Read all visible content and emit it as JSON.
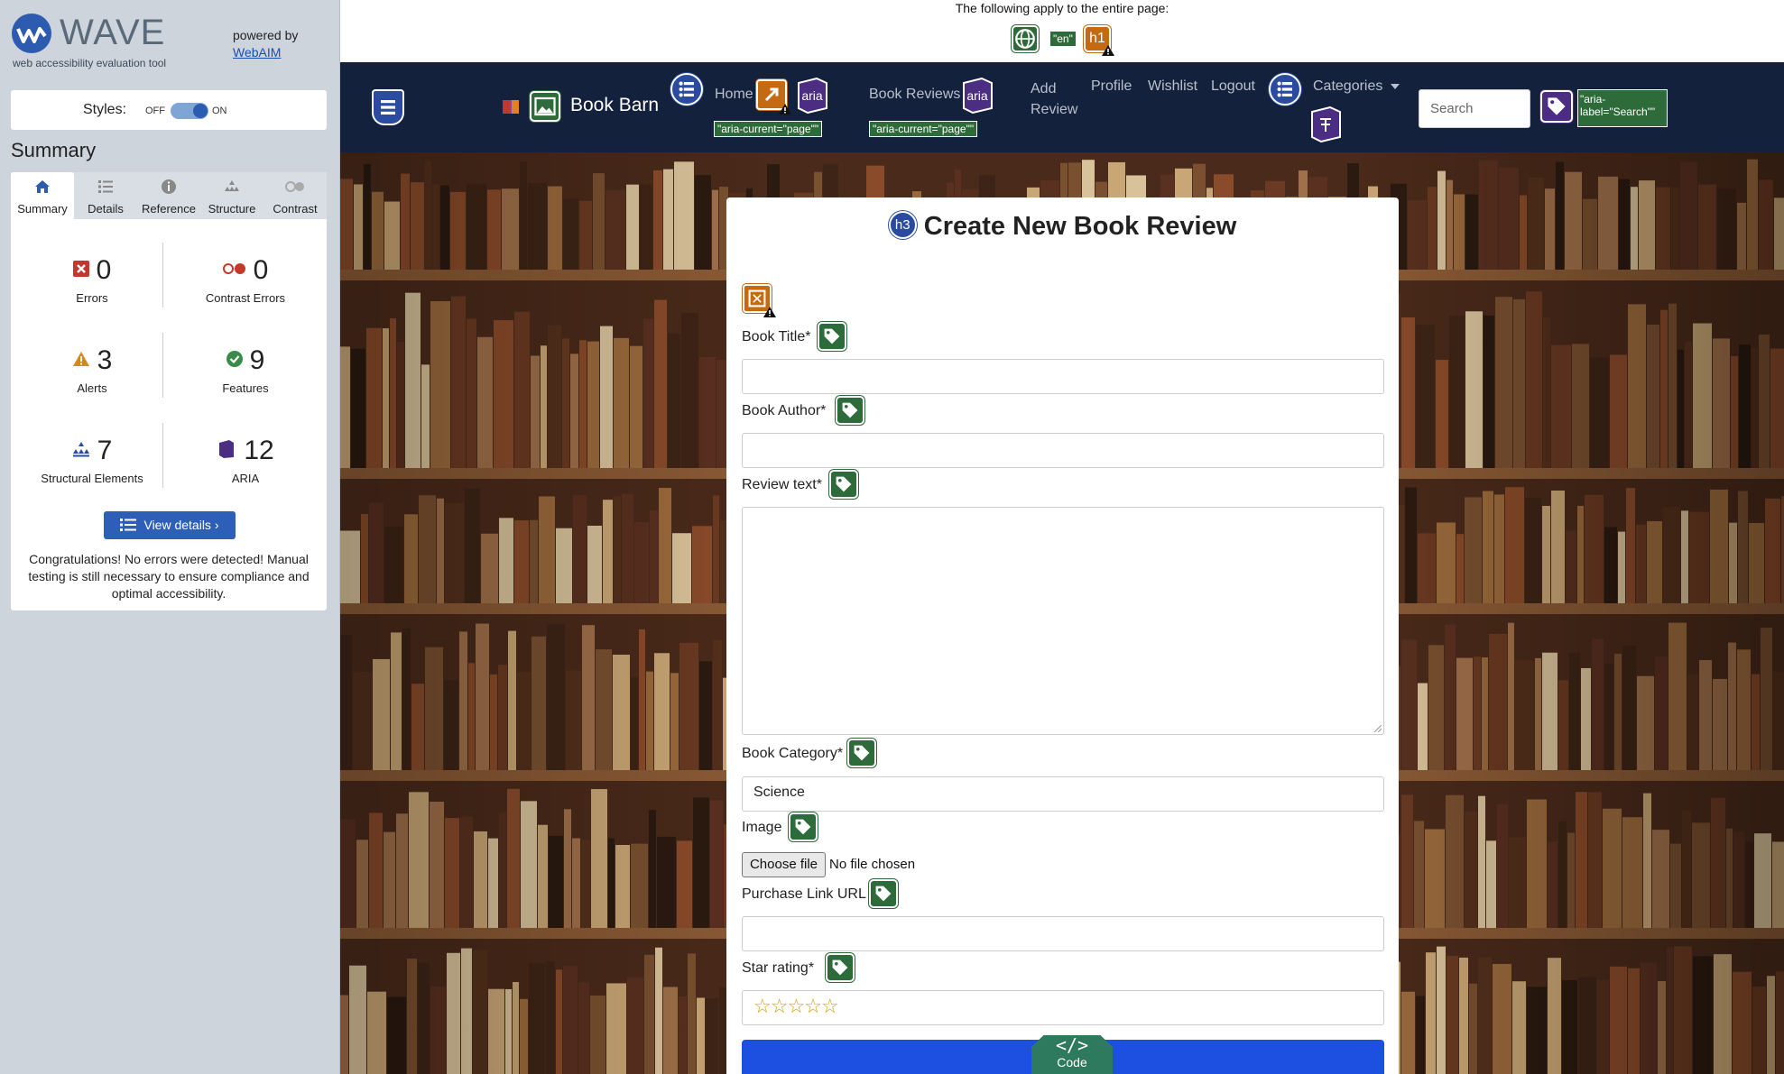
{
  "wave": {
    "title": "WAVE",
    "subtitle": "web accessibility evaluation tool",
    "powered_by": "powered by",
    "webaim": "WebAIM",
    "styles_label": "Styles:",
    "styles_off": "OFF",
    "styles_on": "ON",
    "summary_heading": "Summary",
    "tabs": [
      {
        "label": "Summary",
        "icon": "home-icon"
      },
      {
        "label": "Details",
        "icon": "list-icon"
      },
      {
        "label": "Reference",
        "icon": "info-icon"
      },
      {
        "label": "Structure",
        "icon": "structure-icon"
      },
      {
        "label": "Contrast",
        "icon": "contrast-icon"
      }
    ],
    "stats": [
      {
        "value": "0",
        "label": "Errors",
        "color": "#c0392b"
      },
      {
        "value": "0",
        "label": "Contrast Errors",
        "color": "#c0392b"
      },
      {
        "value": "3",
        "label": "Alerts",
        "color": "#d6891a"
      },
      {
        "value": "9",
        "label": "Features",
        "color": "#3a8a4a"
      },
      {
        "value": "7",
        "label": "Structural Elements",
        "color": "#2a4ba0"
      },
      {
        "value": "12",
        "label": "ARIA",
        "color": "#4b2e83"
      }
    ],
    "view_details": "View details ›",
    "congrats": "Congratulations! No errors were detected! Manual testing is still necessary to ensure compliance and optimal accessibility."
  },
  "page": {
    "top_note": "The following apply to the entire page:",
    "lang_label": "\"en\"",
    "h1_label": "h1",
    "brand": "Book Barn",
    "nav": {
      "home": "Home",
      "book_reviews": "Book Reviews",
      "add_review_1": "Add",
      "add_review_2": "Review",
      "profile": "Profile",
      "wishlist": "Wishlist",
      "logout": "Logout",
      "categories": "Categories"
    },
    "aria_current": "\"aria-current=\"page\"\"",
    "aria_text": "aria",
    "search_placeholder": "Search",
    "search_aria_1": "\"aria-",
    "search_aria_2": "label=\"Search\"\"",
    "form": {
      "heading": "Create New Book Review",
      "h3_badge": "h3",
      "book_title": "Book Title*",
      "book_author": "Book Author*",
      "review_text": "Review text*",
      "book_category": "Book Category*",
      "category_value": "Science",
      "image": "Image",
      "choose_file": "Choose file",
      "no_file": "No file chosen",
      "purchase_link": "Purchase Link URL",
      "star_rating": "Star rating*",
      "stars": "☆☆☆☆☆"
    },
    "code_tab": "Code"
  }
}
